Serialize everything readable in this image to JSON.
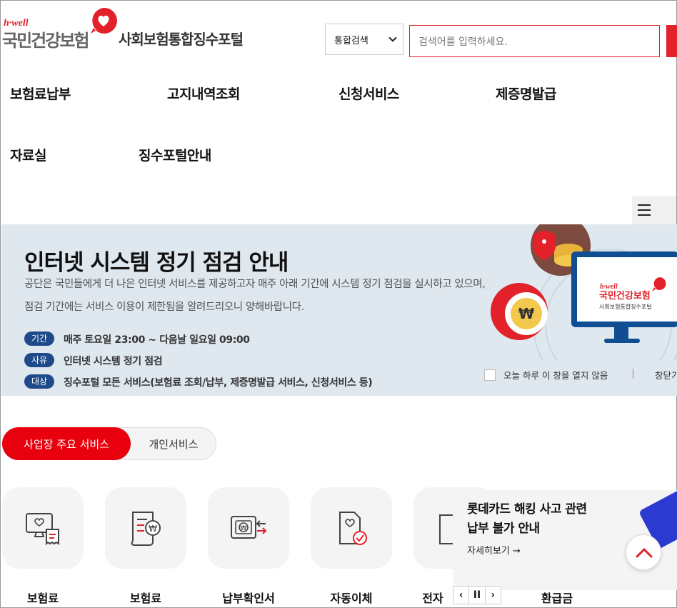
{
  "header": {
    "logo_small": "h·well",
    "logo_main": "국민건강보험",
    "portal_title": "사회보험통합징수포털",
    "search_scope": "통합검색",
    "search_placeholder": "검색어를 입력하세요."
  },
  "nav": {
    "items": [
      "보험료납부",
      "고지내역조회",
      "신청서비스",
      "제증명발급",
      "자료실",
      "징수포털안내"
    ]
  },
  "notice": {
    "title": "인터넷 시스템 정기 점검 안내",
    "desc_line1": "공단은 국민들에게 더 나은 인터넷 서비스를 제공하고자 매주 아래 기간에 시스템 정기 점검을 실시하고 있으며,",
    "desc_line2": "점검 기간에는 서비스 이용이 제한됨을 알려드리오니 양해바랍니다.",
    "rows": [
      {
        "tag": "기간",
        "text": "매주 토요일 23:00 ~ 다음날 일요일 09:00"
      },
      {
        "tag": "사유",
        "text": "인터넷 시스템 정기 점검"
      },
      {
        "tag": "대상",
        "text": "징수포털 모든 서비스(보험료 조회/납부, 제증명발급 서비스, 신청서비스 등)"
      }
    ],
    "dont_show_today": "오늘 하루 이 창을 열지 않음",
    "close_label": "창닫기",
    "monitor_logo_small": "h·well",
    "monitor_logo_main": "국민건강보험",
    "monitor_subtitle": "사회보험통합징수포털",
    "colors": {
      "bg": "#dfe7ef",
      "tag": "#1f4a8a"
    }
  },
  "tabs": {
    "active": "사업장 주요 서비스",
    "inactive": "개인서비스"
  },
  "services": [
    {
      "label": "보험료",
      "icon": "monitor-receipt-icon"
    },
    {
      "label": "보험료",
      "icon": "document-won-icon"
    },
    {
      "label": "납부확인서",
      "icon": "wallet-transfer-icon"
    },
    {
      "label": "자동이체",
      "icon": "document-check-icon"
    },
    {
      "label": "전자",
      "icon": "document-icon"
    },
    {
      "label": "환급금",
      "icon": "refund-icon"
    }
  ],
  "ad": {
    "line1": "롯데카드 해킹 사고 관련",
    "line2": "납부 불가 안내",
    "more": "자세히보기 →",
    "prev": "‹",
    "pause": "II",
    "next": "›"
  },
  "accent": "#e2212a"
}
